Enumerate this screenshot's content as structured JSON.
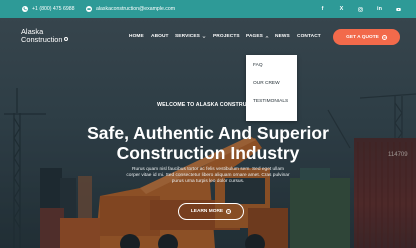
{
  "topbar": {
    "phone": "+1 (800) 475 6988",
    "email": "alaskaconstruction@example.com",
    "social": [
      {
        "icon": "facebook-icon",
        "label": "f"
      },
      {
        "icon": "x-icon",
        "label": "X"
      },
      {
        "icon": "instagram-icon",
        "label": ""
      },
      {
        "icon": "linkedin-icon",
        "label": "in"
      },
      {
        "icon": "youtube-icon",
        "label": ""
      }
    ]
  },
  "brand": {
    "line1": "Alaska",
    "line2": "Construction"
  },
  "nav": {
    "home": "HOME",
    "about": "ABOUT",
    "services": "SERVICES",
    "projects": "PROJECTS",
    "pages": "PAGES",
    "news": "NEWS",
    "contact": "CONTACT"
  },
  "cta": {
    "label": "GET A QUOTE"
  },
  "dropdown": {
    "items": [
      "FAQ",
      "OUR CREW",
      "TESTIMONIALS"
    ]
  },
  "hero": {
    "eyebrow": "WELCOME TO ALASKA CONSTRUCTION",
    "title_line1": "Safe, Authentic And Superior",
    "title_line2": "Construction Industry",
    "sub_line1": "Rurus quam nisl faucibus tortor ac felis vestibulum sem. Sed eget ullam",
    "sub_line2": "corper vitae id mi. Sed consectetur libero aliquam ornare amet. Cras pulvinar",
    "sub_line3": "purus urna turpis leo dolor cursus.",
    "button": "LEARN MORE"
  },
  "colors": {
    "topbar": "#2e9a97",
    "accent": "#f26a4b",
    "crane": "#c86a2a"
  }
}
